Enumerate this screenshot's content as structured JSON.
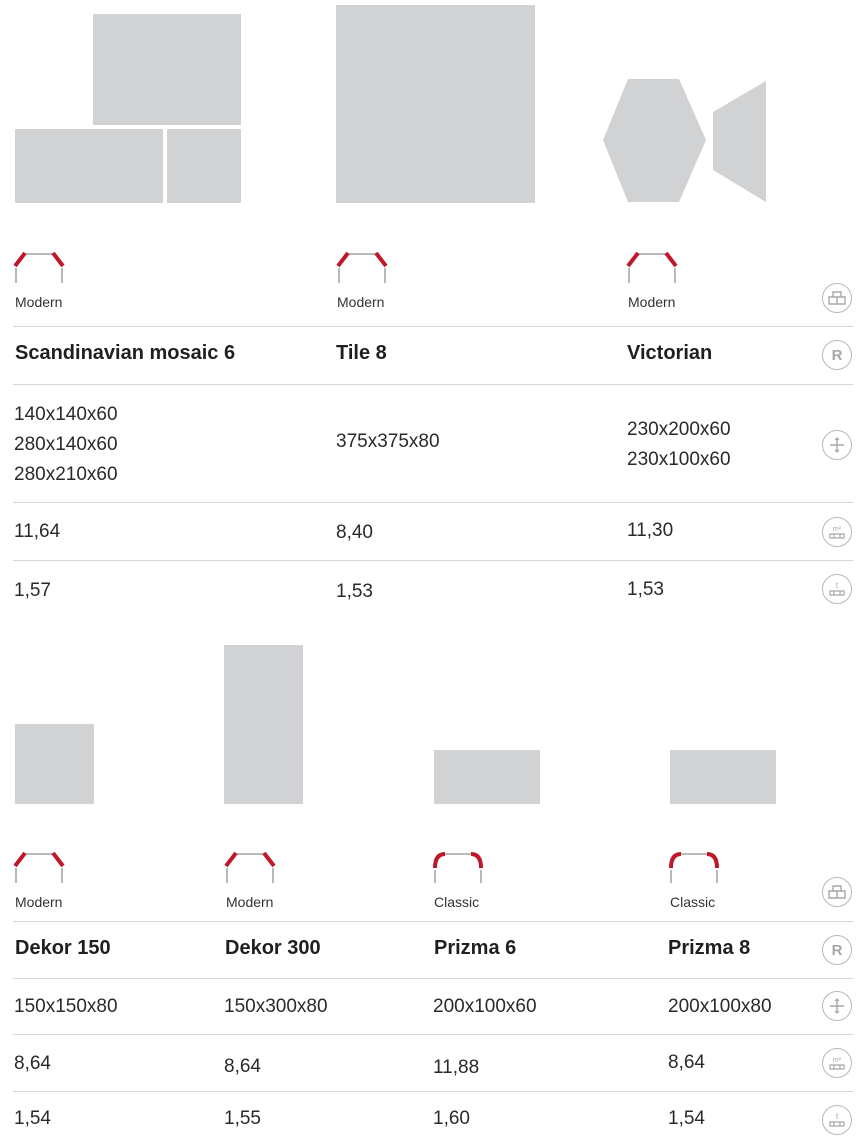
{
  "section1": {
    "products": [
      {
        "edge": "Modern",
        "name": "Scandinavian mosaic 6",
        "sizes": "140x140x60\n280x140x60\n280x210x60",
        "area": "11,64",
        "weight": "1,57"
      },
      {
        "edge": "Modern",
        "name": "Tile 8",
        "sizes": "375x375x80",
        "area": "8,40",
        "weight": "1,53"
      },
      {
        "edge": "Modern",
        "name": "Victorian",
        "sizes": "230x200x60\n230x100x60",
        "area": "11,30",
        "weight": "1,53"
      }
    ]
  },
  "section2": {
    "products": [
      {
        "edge": "Modern",
        "name": "Dekor 150",
        "sizes": "150x150x80",
        "area": "8,64",
        "weight": "1,54"
      },
      {
        "edge": "Modern",
        "name": "Dekor 300",
        "sizes": "150x300x80",
        "area": "8,64",
        "weight": "1,55"
      },
      {
        "edge": "Classic",
        "name": "Prizma 6",
        "sizes": "200x100x60",
        "area": "11,88",
        "weight": "1,60"
      },
      {
        "edge": "Classic",
        "name": "Prizma 8",
        "sizes": "200x100x80",
        "area": "8,64",
        "weight": "1,54"
      }
    ]
  },
  "row_icons": {
    "edge": "edge-profile-icon",
    "name": "registered-icon",
    "name_letter": "R",
    "sizes": "dimensions-icon",
    "area": "square-meter-pallet-icon",
    "area_unit": "m²",
    "weight": "tonne-pallet-icon",
    "weight_unit": "t"
  },
  "colors": {
    "accent": "#c0182a",
    "shape": "#d1d2d4",
    "divider": "#d6d6d6"
  }
}
